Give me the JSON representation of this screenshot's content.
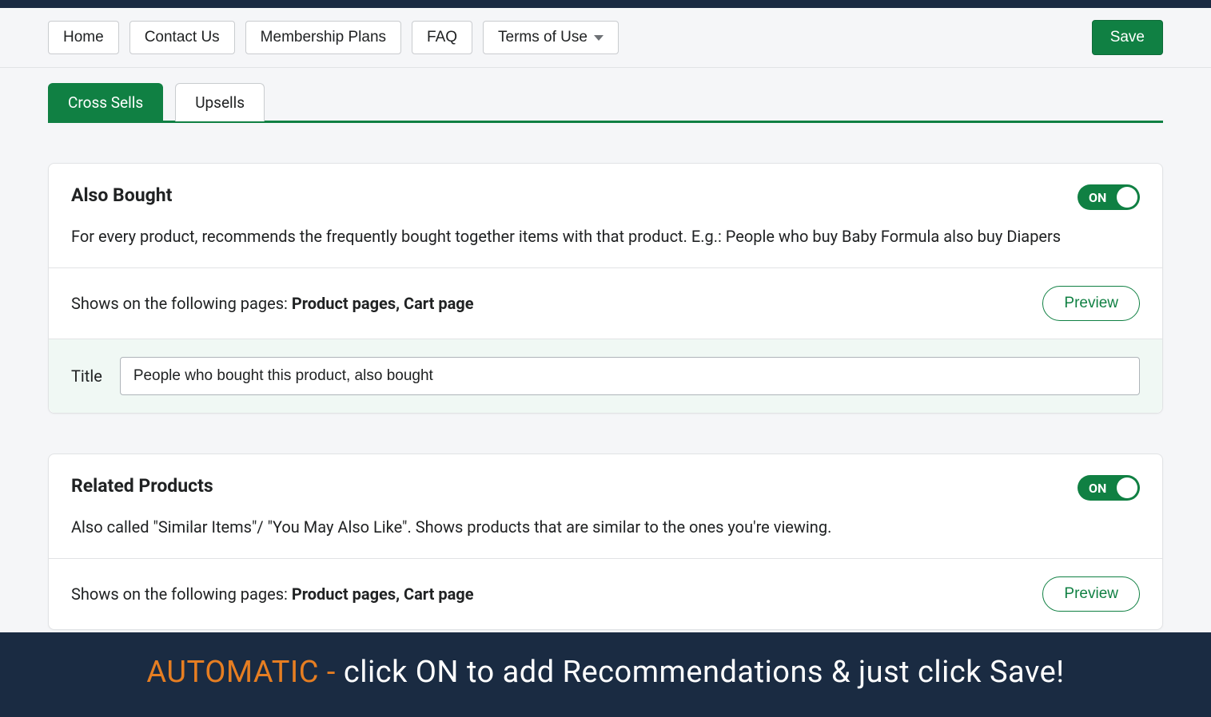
{
  "nav": {
    "items": [
      {
        "label": "Home"
      },
      {
        "label": "Contact Us"
      },
      {
        "label": "Membership Plans"
      },
      {
        "label": "FAQ"
      },
      {
        "label": "Terms of Use",
        "dropdown": true
      }
    ],
    "save": "Save"
  },
  "tabs": [
    {
      "label": "Cross Sells",
      "active": true
    },
    {
      "label": "Upsells",
      "active": false
    }
  ],
  "sections": [
    {
      "title": "Also Bought",
      "toggle": "ON",
      "description": "For every product, recommends the frequently bought together items with that product. E.g.: People who buy Baby Formula also buy Diapers",
      "pages_prefix": "Shows on the following pages: ",
      "pages_value": "Product pages, Cart page",
      "preview": "Preview",
      "title_field_label": "Title",
      "title_field_value": "People who bought this product, also bought"
    },
    {
      "title": "Related Products",
      "toggle": "ON",
      "description": "Also called \"Similar Items\"/ \"You May Also Like\". Shows products that are similar to the ones you're viewing.",
      "pages_prefix": "Shows on the following pages: ",
      "pages_value": "Product pages, Cart page",
      "preview": "Preview"
    }
  ],
  "banner": {
    "accent": "AUTOMATIC - ",
    "rest": "click ON to add Recommendations & just click Save!"
  }
}
